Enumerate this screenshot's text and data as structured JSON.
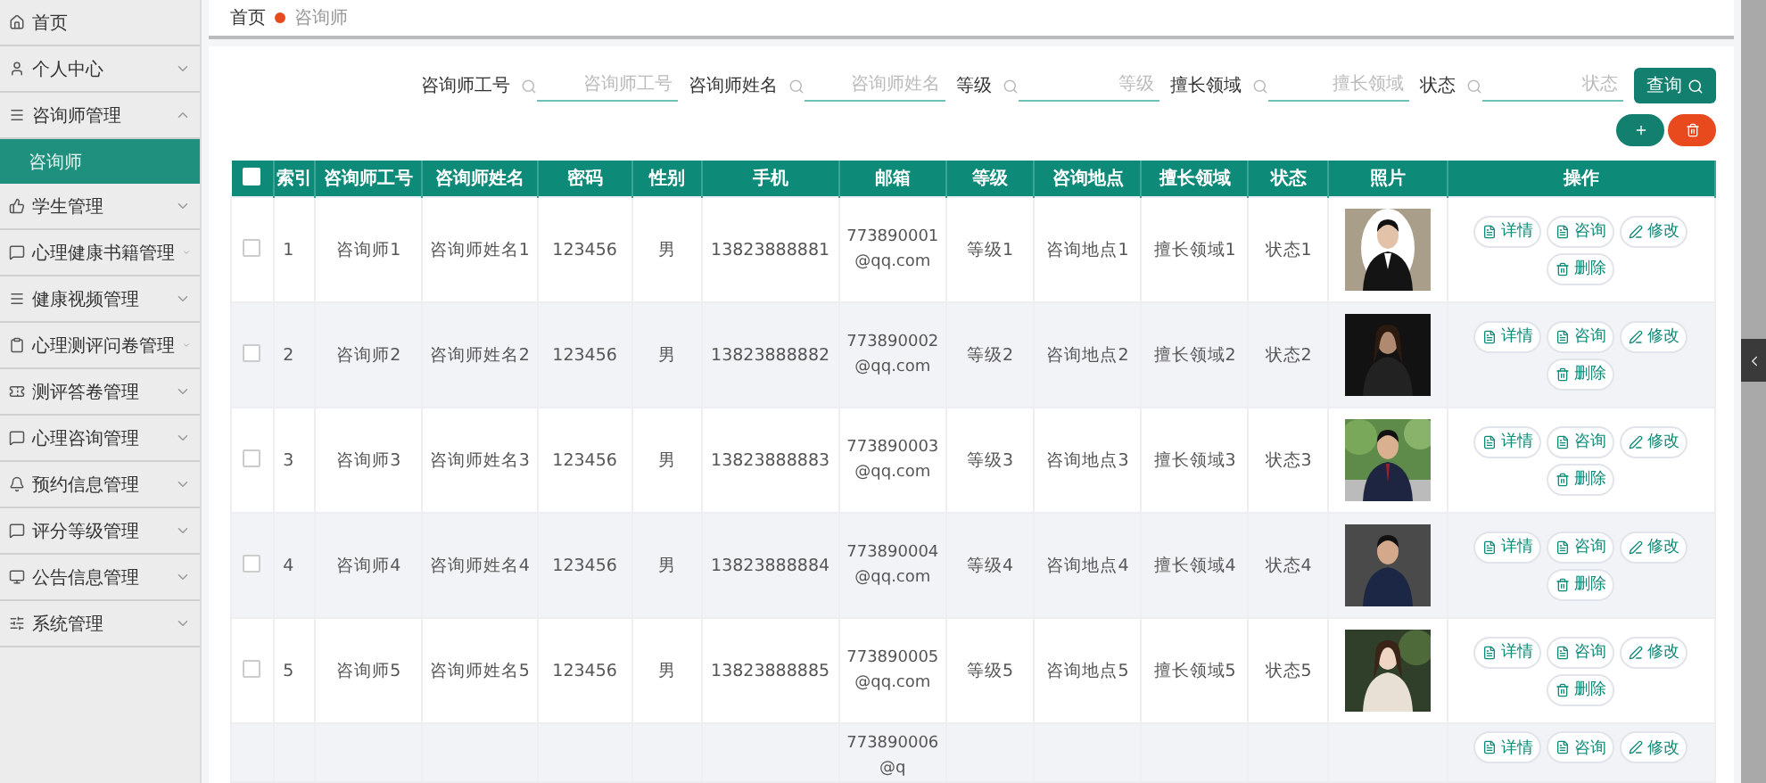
{
  "sidebar": {
    "items": [
      {
        "label": "首页"
      },
      {
        "label": "个人中心",
        "expanded": false
      },
      {
        "label": "咨询师管理",
        "expanded": true,
        "children": [
          {
            "label": "咨询师",
            "selected": true
          }
        ]
      },
      {
        "label": "学生管理",
        "expanded": false
      },
      {
        "label": "心理健康书籍管理",
        "expanded": false
      },
      {
        "label": "健康视频管理",
        "expanded": false
      },
      {
        "label": "心理测评问卷管理",
        "expanded": false
      },
      {
        "label": "测评答卷管理",
        "expanded": false
      },
      {
        "label": "心理咨询管理",
        "expanded": false
      },
      {
        "label": "预约信息管理",
        "expanded": false
      },
      {
        "label": "评分等级管理",
        "expanded": false
      },
      {
        "label": "公告信息管理",
        "expanded": false
      },
      {
        "label": "系统管理",
        "expanded": false
      }
    ]
  },
  "breadcrumb": [
    "首页",
    "咨询师"
  ],
  "search": {
    "fields": [
      {
        "label": "咨询师工号",
        "placeholder": "咨询师工号"
      },
      {
        "label": "咨询师姓名",
        "placeholder": "咨询师姓名"
      },
      {
        "label": "等级",
        "placeholder": "等级"
      },
      {
        "label": "擅长领域",
        "placeholder": "擅长领域"
      },
      {
        "label": "状态",
        "placeholder": "状态"
      }
    ],
    "button": "查询"
  },
  "table": {
    "all_checked": false,
    "columns": [
      "索引",
      "咨询师工号",
      "咨询师姓名",
      "密码",
      "性别",
      "手机",
      "邮箱",
      "等级",
      "咨询地点",
      "擅长领域",
      "状态",
      "照片",
      "操作"
    ],
    "rows": [
      {
        "checked": false,
        "index": "1",
        "id": "咨询师1",
        "name": "咨询师姓名1",
        "password": "123456",
        "gender": "男",
        "phone": "13823888881",
        "email": "773890001@qq.com",
        "level": "等级1",
        "location": "咨询地点1",
        "field": "擅长领域1",
        "status": "状态1",
        "photo": {
          "kind": "picture"
        },
        "actions": [
          "详情",
          "咨询",
          "修改",
          "删除"
        ]
      },
      {
        "checked": false,
        "index": "2",
        "id": "咨询师2",
        "name": "咨询师姓名2",
        "password": "123456",
        "gender": "男",
        "phone": "13823888882",
        "email": "773890002@qq.com",
        "level": "等级2",
        "location": "咨询地点2",
        "field": "擅长领域2",
        "status": "状态2",
        "photo": {
          "kind": "picture"
        },
        "actions": [
          "详情",
          "咨询",
          "修改",
          "删除"
        ]
      },
      {
        "checked": false,
        "index": "3",
        "id": "咨询师3",
        "name": "咨询师姓名3",
        "password": "123456",
        "gender": "男",
        "phone": "13823888883",
        "email": "773890003@qq.com",
        "level": "等级3",
        "location": "咨询地点3",
        "field": "擅长领域3",
        "status": "状态3",
        "photo": {
          "kind": "picture"
        },
        "actions": [
          "详情",
          "咨询",
          "修改",
          "删除"
        ]
      },
      {
        "checked": false,
        "index": "4",
        "id": "咨询师4",
        "name": "咨询师姓名4",
        "password": "123456",
        "gender": "男",
        "phone": "13823888884",
        "email": "773890004@qq.com",
        "level": "等级4",
        "location": "咨询地点4",
        "field": "擅长领域4",
        "status": "状态4",
        "photo": {
          "kind": "picture"
        },
        "actions": [
          "详情",
          "咨询",
          "修改",
          "删除"
        ]
      },
      {
        "checked": false,
        "index": "5",
        "id": "咨询师5",
        "name": "咨询师姓名5",
        "password": "123456",
        "gender": "男",
        "phone": "13823888885",
        "email": "773890005@qq.com",
        "level": "等级5",
        "location": "咨询地点5",
        "field": "擅长领域5",
        "status": "状态5",
        "photo": {
          "kind": "picture"
        },
        "actions": [
          "详情",
          "咨询",
          "修改",
          "删除"
        ]
      },
      {
        "email": "773890006@q",
        "actions": [
          "详情",
          "咨询",
          "修改"
        ]
      }
    ]
  }
}
